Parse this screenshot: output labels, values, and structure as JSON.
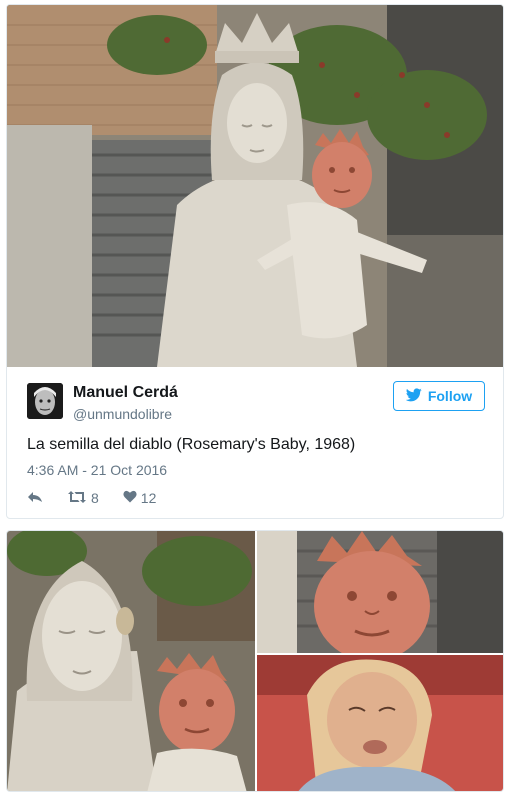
{
  "tweet": {
    "display_name": "Manuel Cerdá",
    "screen_name": "@unmundolibre",
    "text": "La semilla del diablo (Rosemary's Baby, 1968)",
    "timestamp": "4:36 AM - 21 Oct 2016",
    "follow_label": "Follow",
    "retweet_count": "8",
    "like_count": "12"
  },
  "icons": {
    "reply": "reply-icon",
    "retweet": "retweet-icon",
    "like": "heart-icon",
    "follow": "twitter-bird-icon"
  },
  "colors": {
    "accent": "#1da1f2",
    "text_primary": "#14171a",
    "text_secondary": "#657786",
    "border": "#e1e8ed"
  }
}
